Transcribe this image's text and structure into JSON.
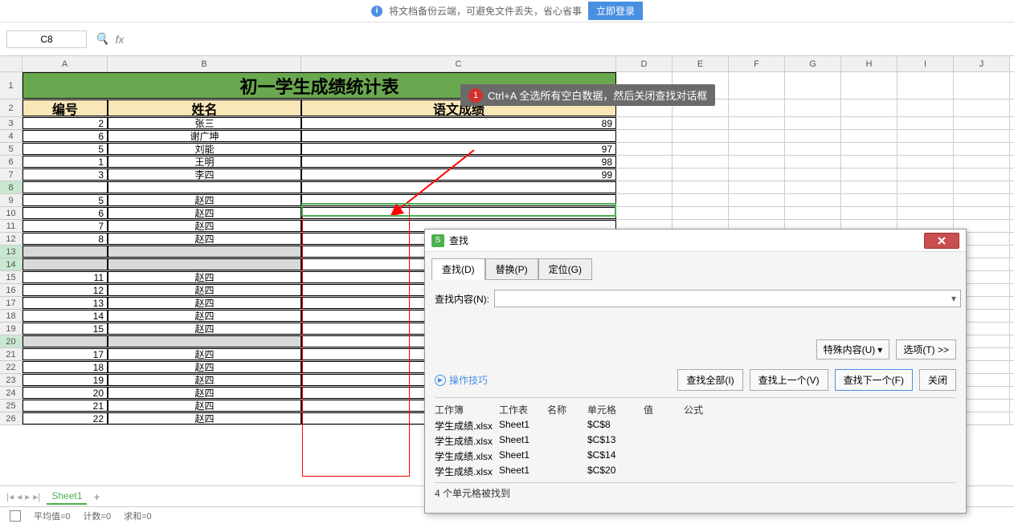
{
  "banner": {
    "text": "将文档备份云端，可避免文件丢失，省心省事",
    "btn": "立即登录"
  },
  "formula_bar": {
    "cell_ref": "C8",
    "fx": "fx"
  },
  "cols": [
    "A",
    "B",
    "C",
    "D",
    "E",
    "F",
    "G",
    "H",
    "I",
    "J"
  ],
  "title": "初一学生成绩统计表",
  "headers": {
    "a": "编号",
    "b": "姓名",
    "c": "语文成绩"
  },
  "rows": [
    {
      "n": 3,
      "a": "2",
      "b": "张三",
      "c": "89"
    },
    {
      "n": 4,
      "a": "6",
      "b": "谢广坤",
      "c": ""
    },
    {
      "n": 5,
      "a": "5",
      "b": "刘能",
      "c": "97"
    },
    {
      "n": 6,
      "a": "1",
      "b": "王明",
      "c": "98"
    },
    {
      "n": 7,
      "a": "3",
      "b": "李四",
      "c": "99"
    },
    {
      "n": 8,
      "a": "",
      "b": "",
      "c": "",
      "sel": true
    },
    {
      "n": 9,
      "a": "5",
      "b": "赵四",
      "c": ""
    },
    {
      "n": 10,
      "a": "6",
      "b": "赵四",
      "c": ""
    },
    {
      "n": 11,
      "a": "7",
      "b": "赵四",
      "c": ""
    },
    {
      "n": 12,
      "a": "8",
      "b": "赵四",
      "c": ""
    },
    {
      "n": 13,
      "a": "",
      "b": "",
      "c": "",
      "hl": true,
      "sel": true
    },
    {
      "n": 14,
      "a": "",
      "b": "",
      "c": "",
      "hl": true,
      "sel": true
    },
    {
      "n": 15,
      "a": "11",
      "b": "赵四",
      "c": ""
    },
    {
      "n": 16,
      "a": "12",
      "b": "赵四",
      "c": ""
    },
    {
      "n": 17,
      "a": "13",
      "b": "赵四",
      "c": ""
    },
    {
      "n": 18,
      "a": "14",
      "b": "赵四",
      "c": ""
    },
    {
      "n": 19,
      "a": "15",
      "b": "赵四",
      "c": ""
    },
    {
      "n": 20,
      "a": "",
      "b": "",
      "c": "",
      "hl": true,
      "sel": true
    },
    {
      "n": 21,
      "a": "17",
      "b": "赵四",
      "c": ""
    },
    {
      "n": 22,
      "a": "18",
      "b": "赵四",
      "c": ""
    },
    {
      "n": 23,
      "a": "19",
      "b": "赵四",
      "c": ""
    },
    {
      "n": 24,
      "a": "20",
      "b": "赵四",
      "c": ""
    },
    {
      "n": 25,
      "a": "21",
      "b": "赵四",
      "c": ""
    },
    {
      "n": 26,
      "a": "22",
      "b": "赵四",
      "c": ""
    }
  ],
  "callout": {
    "num": "1",
    "text": "Ctrl+A 全选所有空白数据，然后关闭查找对话框"
  },
  "dialog": {
    "title": "查找",
    "tabs": {
      "find": "查找(D)",
      "replace": "替换(P)",
      "goto": "定位(G)"
    },
    "search_label": "查找内容(N):",
    "special_btn": "特殊内容(U)",
    "options_btn": "选项(T) >>",
    "tips": "操作技巧",
    "find_all": "查找全部(I)",
    "find_prev": "查找上一个(V)",
    "find_next": "查找下一个(F)",
    "close": "关闭",
    "res_headers": {
      "wb": "工作簿",
      "ws": "工作表",
      "nm": "名称",
      "cl": "单元格",
      "vl": "值",
      "fx": "公式"
    },
    "results": [
      {
        "wb": "学生成绩.xlsx",
        "ws": "Sheet1",
        "nm": "",
        "cl": "$C$8",
        "vl": "",
        "fx": ""
      },
      {
        "wb": "学生成绩.xlsx",
        "ws": "Sheet1",
        "nm": "",
        "cl": "$C$13",
        "vl": "",
        "fx": ""
      },
      {
        "wb": "学生成绩.xlsx",
        "ws": "Sheet1",
        "nm": "",
        "cl": "$C$14",
        "vl": "",
        "fx": ""
      },
      {
        "wb": "学生成绩.xlsx",
        "ws": "Sheet1",
        "nm": "",
        "cl": "$C$20",
        "vl": "",
        "fx": ""
      }
    ],
    "status": "4 个单元格被找到"
  },
  "sheet": {
    "name": "Sheet1"
  },
  "status_bar": {
    "avg": "平均值=0",
    "count": "计数=0",
    "sum": "求和=0"
  }
}
